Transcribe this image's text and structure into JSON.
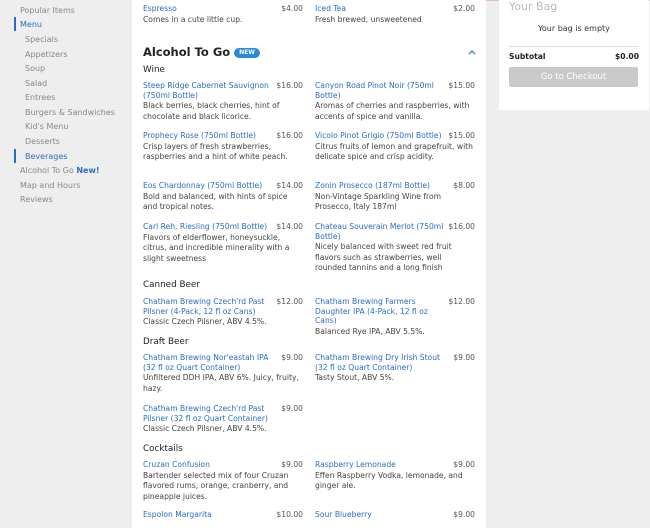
{
  "nav": {
    "popular": "Popular Items",
    "menu": "Menu",
    "specials": "Specials",
    "appetizers": "Appetizers",
    "soup": "Soup",
    "salad": "Salad",
    "entrees": "Entrees",
    "burgers": "Burgers & Sandwiches",
    "kids": "Kid's Menu",
    "desserts": "Desserts",
    "beverages": "Beverages",
    "alcohol": "Alcohol To Go",
    "alcohol_new": "New!",
    "map": "Map and Hours",
    "reviews": "Reviews"
  },
  "top_items": [
    {
      "name": "Espresso",
      "price": "$4.00",
      "desc": "Comes in a cute little cup."
    },
    {
      "name": "Iced Tea",
      "price": "$2.00",
      "desc": "Fresh brewed, unsweetened"
    }
  ],
  "section": {
    "title": "Alcohol To Go",
    "badge": "NEW"
  },
  "subheads": {
    "wine": "Wine",
    "canned": "Canned Beer",
    "draft": "Draft Beer",
    "cocktails": "Cocktails"
  },
  "wine": [
    {
      "name": "Steep Ridge Cabernet Sauvignon (750ml Bottle)",
      "price": "$16.00",
      "desc": "Black berries, black cherries, hint of chocolate and black licorice."
    },
    {
      "name": "Canyon Road Pinot Noir (750ml Bottle)",
      "price": "$15.00",
      "desc": "Aromas of cherries and raspberries, with accents of spice and vanilla."
    },
    {
      "name": "Prophecy Rose (750ml Bottle)",
      "price": "$16.00",
      "desc": "Crisp layers of fresh strawberries, raspberries and a hint of white peach."
    },
    {
      "name": "Vicolo Pinot Grigio (750ml Bottle)",
      "price": "$15.00",
      "desc": "Citrus fruits of lemon and grapefruit, with delicate spice and crisp acidity."
    },
    {
      "name": "Eos Chardonnay (750ml Bottle)",
      "price": "$14.00",
      "desc": "Bold and balanced, with hints of spice and tropical notes."
    },
    {
      "name": "Zonin Prosecco (187ml Bottle)",
      "price": "$8.00",
      "desc": "Non-Vintage Sparkling Wine from Prosecco, Italy 187ml"
    },
    {
      "name": "Carl Reh, Riesling (750ml Bottle)",
      "price": "$14.00",
      "desc": "Flavors of elderflower, honeysuckle, citrus, and incredible minerality with a slight sweetness"
    },
    {
      "name": "Chateau Souverain Merlot (750ml Bottle)",
      "price": "$16.00",
      "desc": "Nicely balanced with sweet red fruit flavors such as strawberries, well rounded tannins and a long finish"
    }
  ],
  "canned": [
    {
      "name": "Chatham Brewing Czech'rd Past Pilsner (4-Pack, 12 fl oz Cans)",
      "price": "$12.00",
      "desc": "Classic Czech Pilsner, ABV 4.5%."
    },
    {
      "name": "Chatham Brewing Farmers Daughter IPA (4-Pack, 12 fl oz Cans)",
      "price": "$12.00",
      "desc": "Balanced Rye IPA, ABV 5.5%."
    }
  ],
  "draft": [
    {
      "name": "Chatham Brewing Nor'eastah IPA (32 fl oz Quart Container)",
      "price": "$9.00",
      "desc": "Unfiltered DDH IPA, ABV 6%. Juicy, fruity, hazy."
    },
    {
      "name": "Chatham Brewing Dry Irish Stout (32 fl oz Quart Container)",
      "price": "$9.00",
      "desc": "Tasty Stout, ABV 5%."
    },
    {
      "name": "Chatham Brewing Czech'rd Past Pilsner (32 fl oz Quart Container)",
      "price": "$9.00",
      "desc": "Classic Czech Pilsner, ABV 4.5%."
    }
  ],
  "cocktails": [
    {
      "name": "Cruzan Confusion",
      "price": "$9.00",
      "desc": "Bartender selected mix of four Cruzan flavored rums, orange, cranberry, and pineapple juices."
    },
    {
      "name": "Raspberry Lemonade",
      "price": "$9.00",
      "desc": "Effen Raspberry Vodka, lemonade, and ginger ale."
    },
    {
      "name": "Espolon Margarita",
      "price": "$10.00",
      "desc": ""
    },
    {
      "name": "Sour Blueberry",
      "price": "$9.00",
      "desc": ""
    }
  ],
  "bag": {
    "title": "Your Bag",
    "empty": "Your bag is empty",
    "subtotal_label": "Subtotal",
    "subtotal_value": "$0.00",
    "checkout": "Go to Checkout"
  },
  "colors": {
    "accent": "#2a6cc4",
    "badge": "#2a8ad8",
    "button_disabled": "#c9c9c9"
  }
}
